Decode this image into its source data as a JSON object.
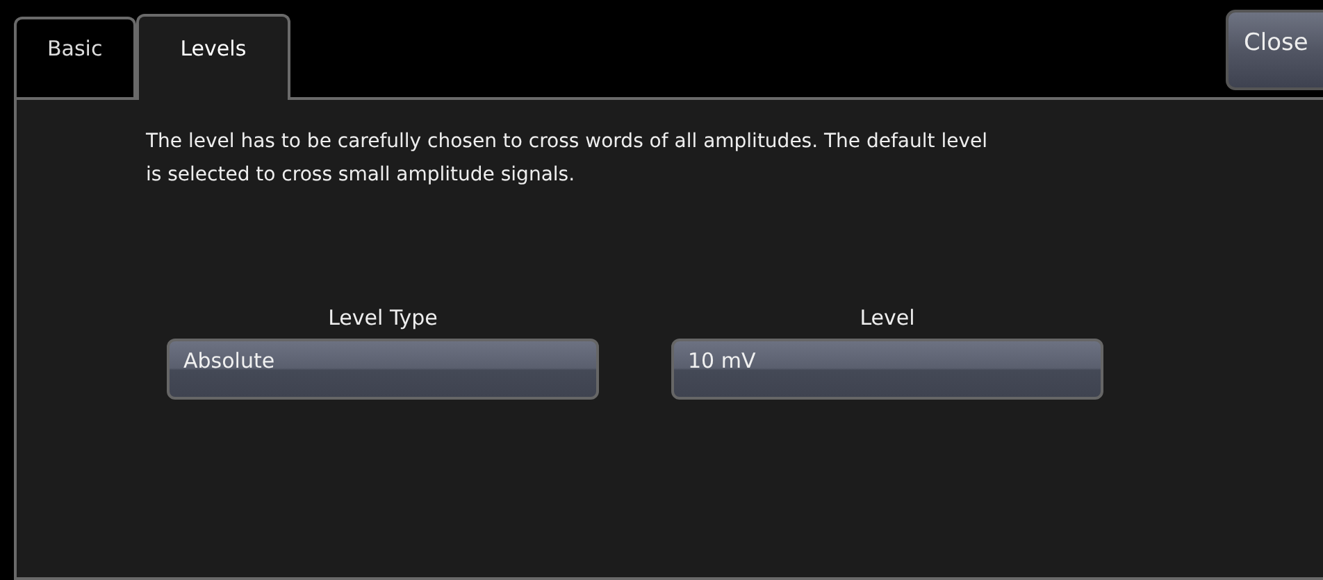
{
  "tabs": [
    {
      "label": "Basic",
      "selected": false
    },
    {
      "label": "Levels",
      "selected": true
    }
  ],
  "close_button": {
    "label": "Close"
  },
  "description": "The level has to be carefully chosen to cross words of all amplitudes. The default level is selected to cross small amplitude signals.",
  "fields": [
    {
      "label": "Level Type",
      "value": "Absolute"
    },
    {
      "label": "Level",
      "value": "10 mV"
    }
  ]
}
